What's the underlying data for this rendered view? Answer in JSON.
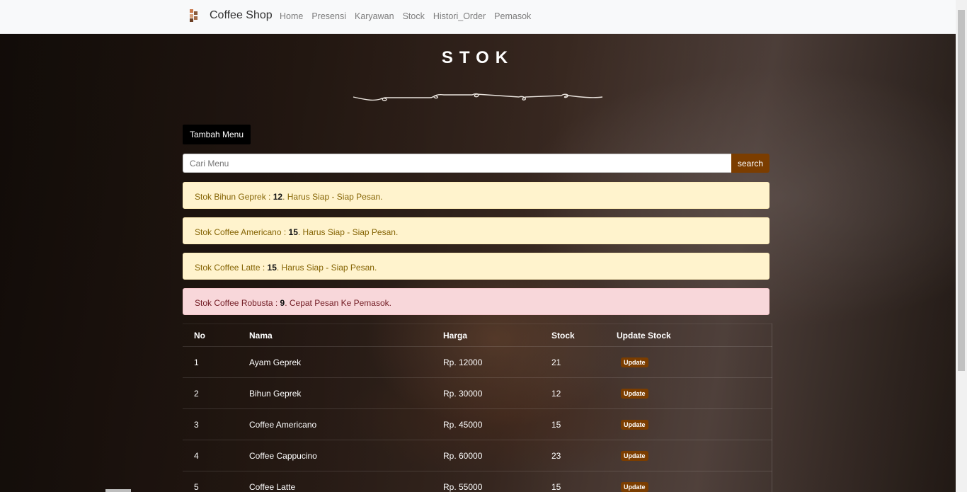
{
  "brand": {
    "name": "Coffee Shop"
  },
  "nav": {
    "items": [
      "Home",
      "Presensi",
      "Karyawan",
      "Stock",
      "Histori_Order",
      "Pemasok"
    ]
  },
  "page": {
    "title": "STOK"
  },
  "actions": {
    "add_label": "Tambah Menu"
  },
  "search": {
    "placeholder": "Cari Menu",
    "button_label": "search"
  },
  "alerts": [
    {
      "type": "warning",
      "prefix": "Stok Bihun Geprek : ",
      "value": "12",
      "suffix": ". Harus Siap - Siap Pesan."
    },
    {
      "type": "warning",
      "prefix": "Stok Coffee Americano : ",
      "value": "15",
      "suffix": ". Harus Siap - Siap Pesan."
    },
    {
      "type": "warning",
      "prefix": "Stok Coffee Latte : ",
      "value": "15",
      "suffix": ". Harus Siap - Siap Pesan."
    },
    {
      "type": "danger",
      "prefix": "Stok Coffee Robusta : ",
      "value": "9",
      "suffix": ". Cepat Pesan Ke Pemasok."
    }
  ],
  "table": {
    "headers": [
      "No",
      "Nama",
      "Harga",
      "Stock",
      "Update Stock"
    ],
    "update_label": "Update",
    "rows": [
      {
        "no": "1",
        "nama": "Ayam Geprek",
        "harga": "Rp. 12000",
        "stock": "21"
      },
      {
        "no": "2",
        "nama": "Bihun Geprek",
        "harga": "Rp. 30000",
        "stock": "12"
      },
      {
        "no": "3",
        "nama": "Coffee Americano",
        "harga": "Rp. 45000",
        "stock": "15"
      },
      {
        "no": "4",
        "nama": "Coffee Cappucino",
        "harga": "Rp. 60000",
        "stock": "23"
      },
      {
        "no": "5",
        "nama": "Coffee Latte",
        "harga": "Rp. 55000",
        "stock": "15"
      }
    ]
  },
  "colors": {
    "accent": "#7b3d00",
    "navbar": "#f8f9fa",
    "warning_bg": "#fff3cd",
    "danger_bg": "#f8d7da"
  }
}
